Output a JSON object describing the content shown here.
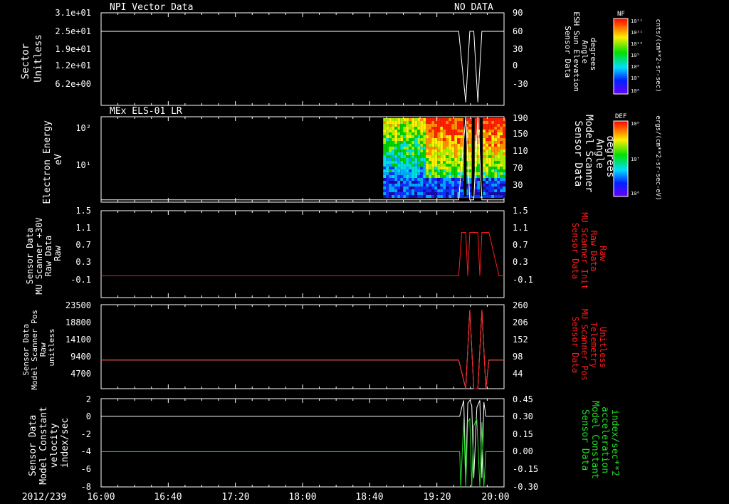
{
  "date_label": "2012/239",
  "time_ticks": [
    "16:00",
    "16:40",
    "17:20",
    "18:00",
    "18:40",
    "19:20",
    "20:00"
  ],
  "colors": {
    "white": "#ffffff",
    "red": "#ff1a1a",
    "green": "#22dd22",
    "background": "#000000"
  },
  "colorbars": [
    {
      "label": "NF",
      "units": "cnts/(cm**2-sr-sec)",
      "ticks": [
        "10¹²",
        "10¹¹",
        "10¹⁰",
        "10⁹",
        "10⁸",
        "10⁷",
        "10⁶"
      ]
    },
    {
      "label": "DEF",
      "units": "ergs/(cm**2-sr-sec-eV)",
      "ticks": [
        "10⁸",
        "10⁷",
        "10⁶"
      ]
    }
  ],
  "chart_data": [
    {
      "type": "line",
      "title_left": "NPI Vector Data",
      "title_right": "NO DATA",
      "ylabel_left": [
        "Sector",
        "Unitless"
      ],
      "ylabel_right": [
        "Sensor Data",
        "ESH Sun Elevation",
        "Angle",
        "degrees"
      ],
      "yticks_left": [
        "3.1e+01",
        "2.5e+01",
        "1.9e+01",
        "1.2e+01",
        "6.2e+00"
      ],
      "yticks_right": [
        "90",
        "60",
        "30",
        "0",
        "-30"
      ],
      "yrange_right": [
        -60,
        90
      ],
      "series": [
        {
          "color": "white",
          "x_hours": [
            16.0,
            19.55,
            19.62,
            19.66,
            19.7,
            19.74,
            19.78,
            19.82,
            19.85,
            20.0
          ],
          "values": [
            60,
            60,
            -55,
            60,
            60,
            -55,
            60,
            60,
            60,
            60
          ]
        }
      ]
    },
    {
      "type": "heatmap",
      "title_left": "MEx ELS-01 LR",
      "ylabel_left": [
        "Electron Energy",
        "eV"
      ],
      "ylabel_right": [
        "Sensor Data",
        "Model Scanner",
        "Angle",
        "degrees"
      ],
      "yticks_left": [
        "10²",
        "10¹"
      ],
      "yticks_right": [
        "190",
        "150",
        "110",
        "70",
        "30"
      ],
      "yrange_right": [
        0,
        190
      ],
      "heatmap_start_hour": 18.8,
      "series": [
        {
          "color": "white",
          "x_hours": [
            16.0,
            19.55,
            19.62,
            19.66,
            19.7,
            19.74,
            19.78,
            19.82,
            19.85,
            20.0
          ],
          "values": [
            5,
            5,
            190,
            5,
            5,
            190,
            5,
            5,
            5,
            5
          ]
        }
      ]
    },
    {
      "type": "line",
      "ylabel_left": [
        "Sensor Data",
        "MU Scanner +30V",
        "Raw Data",
        "Raw"
      ],
      "ylabel_right": [
        "Sensor Data",
        "MU Scanner Init",
        "Raw Data",
        "Raw"
      ],
      "yticks_left": [
        "1.5",
        "1.1",
        "0.7",
        "0.3",
        "-0.1"
      ],
      "yticks_right": [
        "1.5",
        "1.1",
        "0.7",
        "0.3",
        "-0.1"
      ],
      "yrange": [
        -0.5,
        1.5
      ],
      "series": [
        {
          "color": "red",
          "x_hours": [
            16.0,
            19.55,
            19.58,
            19.62,
            19.64,
            19.66,
            19.7,
            19.74,
            19.76,
            19.78,
            19.85,
            19.95,
            20.0
          ],
          "values": [
            0,
            0,
            1,
            1,
            0,
            1,
            1,
            1,
            0,
            1,
            1,
            0,
            0
          ]
        }
      ]
    },
    {
      "type": "line",
      "ylabel_left": [
        "Sensor Data",
        "Model Scanner Pos",
        "Raw",
        "unitless"
      ],
      "ylabel_right": [
        "Sensor Data",
        "MU Scanner Pos",
        "Telemetry",
        "Unitless"
      ],
      "yticks_left": [
        "23500",
        "18800",
        "14100",
        "9400",
        "4700"
      ],
      "yticks_right": [
        "260",
        "206",
        "152",
        "98",
        "44"
      ],
      "yrange_left": [
        0,
        23500
      ],
      "series": [
        {
          "color": "white",
          "x_hours": [
            16.0,
            19.55,
            19.62,
            19.66,
            19.7,
            19.74,
            19.78,
            19.82,
            19.85,
            20.0
          ],
          "values": [
            8000,
            8000,
            0,
            22000,
            0,
            0,
            22000,
            0,
            8000,
            8000
          ]
        },
        {
          "color": "red",
          "x_hours": [
            16.0,
            19.55,
            19.62,
            19.66,
            19.7,
            19.74,
            19.78,
            19.82,
            19.85,
            20.0
          ],
          "values": [
            8000,
            8000,
            0,
            22000,
            0,
            0,
            22000,
            0,
            8000,
            8000
          ]
        }
      ]
    },
    {
      "type": "line",
      "ylabel_left": [
        "Sensor Data",
        "Model Constant",
        "velocity",
        "index/sec"
      ],
      "ylabel_right": [
        "Sensor Data",
        "Model Constant",
        "acceleration",
        "index/sec**2"
      ],
      "yticks_left": [
        "2",
        "0",
        "-2",
        "-4",
        "-6",
        "-8"
      ],
      "yticks_right": [
        "0.45",
        "0.30",
        "0.15",
        "0.00",
        "-0.15",
        "-0.30"
      ],
      "yrange_left": [
        -8,
        2
      ],
      "yrange_right": [
        -0.3,
        0.45
      ],
      "series": [
        {
          "color": "white",
          "axis": "left",
          "x_hours": [
            16.0,
            19.56,
            19.58,
            19.6,
            19.62,
            19.64,
            19.66,
            19.68,
            19.7,
            19.73,
            19.76,
            19.78,
            19.8,
            19.82,
            19.85,
            20.0
          ],
          "values": [
            0,
            0,
            1,
            1.8,
            -7,
            1.5,
            1.8,
            1.2,
            -7,
            1,
            1.8,
            -7,
            1.6,
            0,
            0,
            0
          ]
        },
        {
          "color": "green",
          "axis": "right",
          "x_hours": [
            16.0,
            19.56,
            19.57,
            19.6,
            19.62,
            19.64,
            19.66,
            19.68,
            19.7,
            19.73,
            19.76,
            19.78,
            19.8,
            19.82,
            19.85,
            20.0
          ],
          "values": [
            0,
            0,
            -0.3,
            0.28,
            -0.3,
            0.25,
            0.28,
            -0.3,
            0.22,
            0.28,
            -0.3,
            0.25,
            -0.3,
            0,
            0,
            0
          ]
        }
      ]
    }
  ]
}
